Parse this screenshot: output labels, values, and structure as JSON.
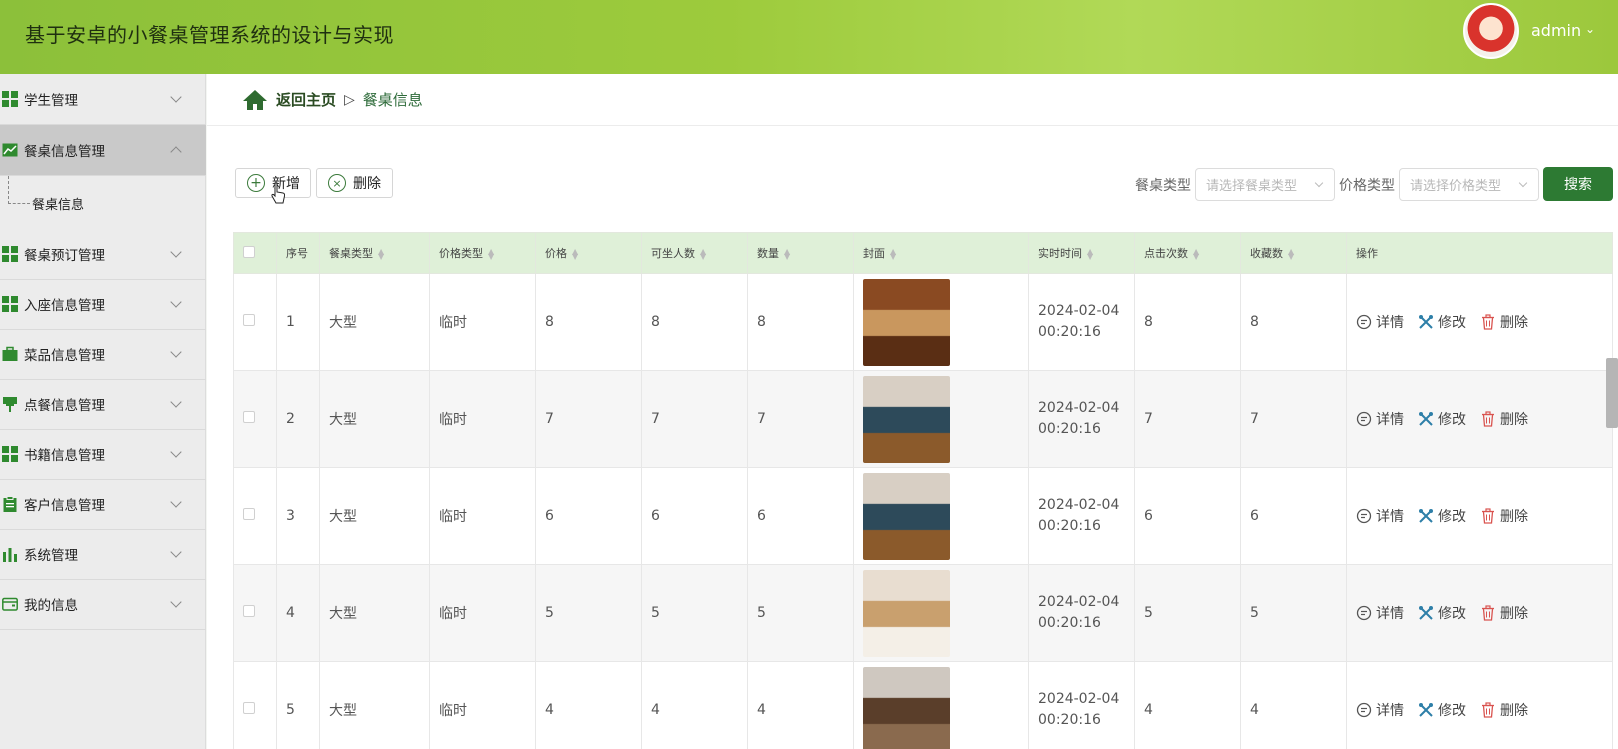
{
  "header": {
    "title": "基于安卓的小餐桌管理系统的设计与实现",
    "user": "admin"
  },
  "sidebar": {
    "items": [
      {
        "label": "学生管理",
        "icon": "grid-icon",
        "expanded": false
      },
      {
        "label": "餐桌信息管理",
        "icon": "chart-icon",
        "expanded": true
      },
      {
        "label": "餐桌预订管理",
        "icon": "grid-icon",
        "expanded": false
      },
      {
        "label": "入座信息管理",
        "icon": "grid-icon",
        "expanded": false
      },
      {
        "label": "菜品信息管理",
        "icon": "briefcase-icon",
        "expanded": false
      },
      {
        "label": "点餐信息管理",
        "icon": "pin-icon",
        "expanded": false
      },
      {
        "label": "书籍信息管理",
        "icon": "grid-icon",
        "expanded": false
      },
      {
        "label": "客户信息管理",
        "icon": "clipboard-icon",
        "expanded": false
      },
      {
        "label": "系统管理",
        "icon": "bar-chart-icon",
        "expanded": false
      },
      {
        "label": "我的信息",
        "icon": "wallet-icon",
        "expanded": false
      }
    ],
    "submenu_label": "餐桌信息"
  },
  "breadcrumb": {
    "home": "返回主页",
    "separator": "▷",
    "current": "餐桌信息"
  },
  "toolbar": {
    "add_label": "新增",
    "delete_label": "删除"
  },
  "search": {
    "table_type_label": "餐桌类型",
    "table_type_placeholder": "请选择餐桌类型",
    "price_type_label": "价格类型",
    "price_type_placeholder": "请选择价格类型",
    "search_label": "搜索"
  },
  "table": {
    "columns": [
      "序号",
      "餐桌类型",
      "价格类型",
      "价格",
      "可坐人数",
      "数量",
      "封面",
      "实时时间",
      "点击次数",
      "收藏数",
      "操作"
    ],
    "rows": [
      {
        "no": "1",
        "table_type": "大型",
        "price_type": "临时",
        "price": "8",
        "seats": "8",
        "count": "8",
        "date": "2024-02-04",
        "time": "00:20:16",
        "clicks": "8",
        "favorites": "8"
      },
      {
        "no": "2",
        "table_type": "大型",
        "price_type": "临时",
        "price": "7",
        "seats": "7",
        "count": "7",
        "date": "2024-02-04",
        "time": "00:20:16",
        "clicks": "7",
        "favorites": "7"
      },
      {
        "no": "3",
        "table_type": "大型",
        "price_type": "临时",
        "price": "6",
        "seats": "6",
        "count": "6",
        "date": "2024-02-04",
        "time": "00:20:16",
        "clicks": "6",
        "favorites": "6"
      },
      {
        "no": "4",
        "table_type": "大型",
        "price_type": "临时",
        "price": "5",
        "seats": "5",
        "count": "5",
        "date": "2024-02-04",
        "time": "00:20:16",
        "clicks": "5",
        "favorites": "5"
      },
      {
        "no": "5",
        "table_type": "大型",
        "price_type": "临时",
        "price": "4",
        "seats": "4",
        "count": "4",
        "date": "2024-02-04",
        "time": "00:20:16",
        "clicks": "4",
        "favorites": "4"
      }
    ],
    "actions": {
      "detail": "详情",
      "edit": "修改",
      "delete": "删除"
    }
  },
  "colors": {
    "header_green": "#9dcb3c",
    "primary_green": "#2d7a33",
    "table_header_bg": "#dff0d8",
    "delete_red": "#d9534f"
  }
}
